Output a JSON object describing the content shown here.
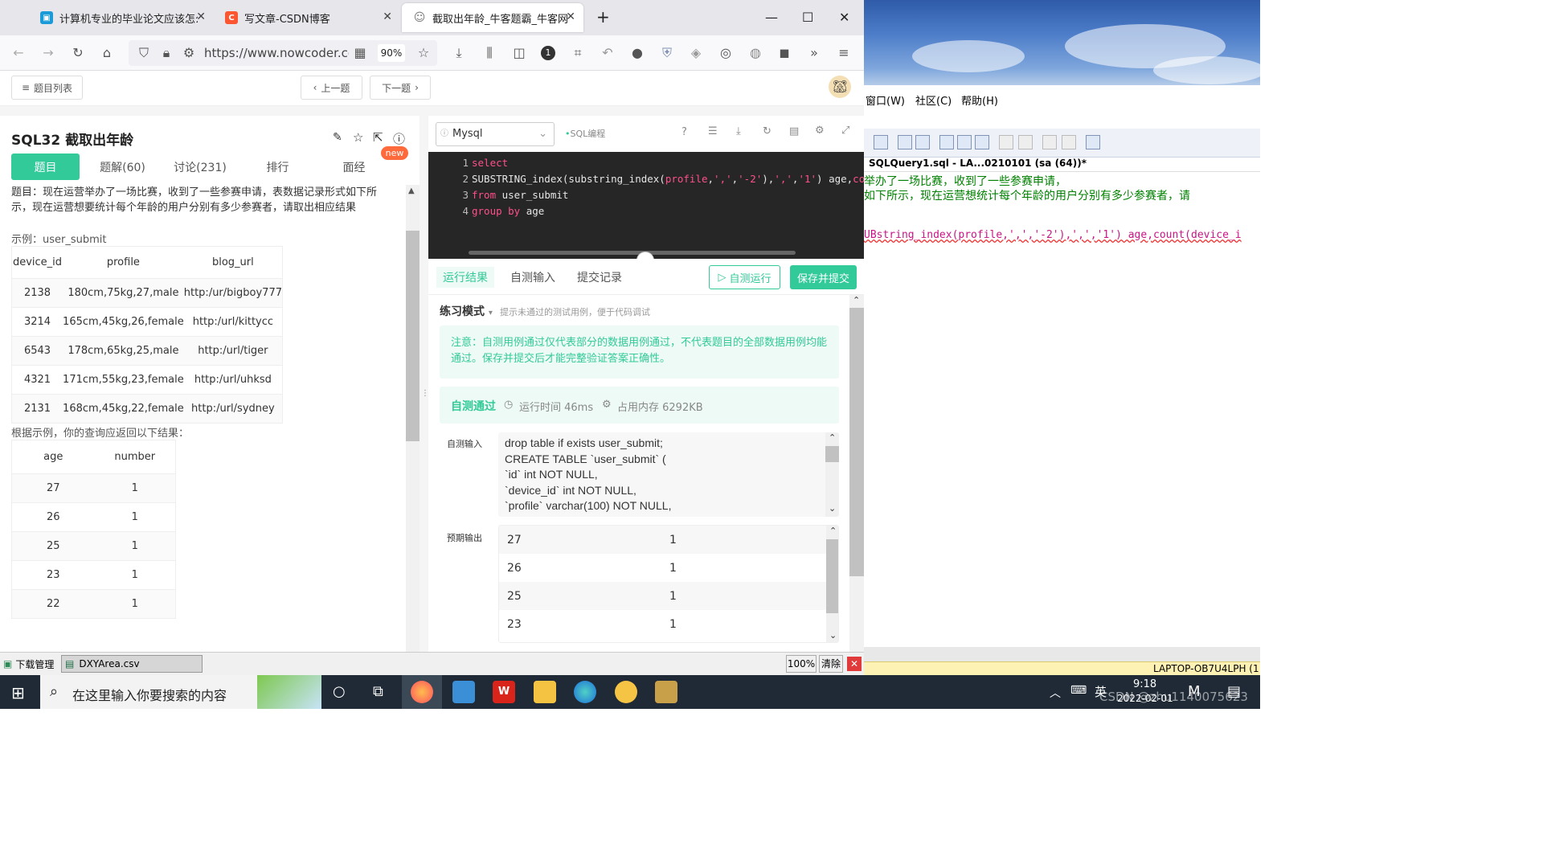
{
  "browser": {
    "tabs": [
      {
        "title": "计算机专业的毕业论文应该怎么"
      },
      {
        "title": "写文章-CSDN博客"
      },
      {
        "title": "截取出年龄_牛客题霸_牛客网"
      }
    ],
    "url": "https://www.nowcoder.com",
    "zoom": "90%"
  },
  "page": {
    "list_button": "题目列表",
    "prev_button": "上一题",
    "next_button": "下一题",
    "title": "SQL32  截取出年龄",
    "new_badge": "new",
    "tabs": [
      "题目",
      "题解(60)",
      "讨论(231)",
      "排行",
      "面经"
    ],
    "description": "题目：现在运营举办了一场比赛，收到了一些参赛申请，表数据记录形式如下所示，现在运营想要统计每个年龄的用户分别有多少参赛者，请取出相应结果",
    "example_label": "示例：user_submit",
    "sample_table": {
      "headers": [
        "device_id",
        "profile",
        "blog_url"
      ],
      "rows": [
        [
          "2138",
          "180cm,75kg,27,male",
          "http:/ur/bigboy777"
        ],
        [
          "3214",
          "165cm,45kg,26,female",
          "http:/url/kittycc"
        ],
        [
          "6543",
          "178cm,65kg,25,male",
          "http:/url/tiger"
        ],
        [
          "4321",
          "171cm,55kg,23,female",
          "http:/url/uhksd"
        ],
        [
          "2131",
          "168cm,45kg,22,female",
          "http:/url/sydney"
        ]
      ]
    },
    "result_label": "根据示例，你的查询应返回以下结果：",
    "result_table": {
      "headers": [
        "age",
        "number"
      ],
      "rows": [
        [
          "27",
          "1"
        ],
        [
          "26",
          "1"
        ],
        [
          "25",
          "1"
        ],
        [
          "23",
          "1"
        ],
        [
          "22",
          "1"
        ]
      ]
    }
  },
  "editor": {
    "language": "Mysql",
    "mode_label": "SQL编程",
    "lines": [
      {
        "n": "1",
        "html": "select"
      },
      {
        "n": "2",
        "html": "SUBSTRING_index(substring_index(profile,',','-2'),',','1') age,count"
      },
      {
        "n": "3",
        "html": "from user_submit"
      },
      {
        "n": "4",
        "html": "group by age"
      }
    ]
  },
  "results": {
    "tabs": [
      "运行结果",
      "自测输入",
      "提交记录"
    ],
    "run_button": "自测运行",
    "submit_button": "保存并提交",
    "practice_mode": "练习模式",
    "practice_hint": "提示未通过的测试用例，便于代码调试",
    "notice": "注意：自测用例通过仅代表部分的数据用例通过，不代表题目的全部数据用例均能通过。保存并提交后才能完整验证答案正确性。",
    "pass_label": "自测通过",
    "runtime": "运行时间 46ms",
    "memory": "占用内存 6292KB",
    "input_label": "自测输入",
    "input_lines": [
      "drop table if exists user_submit;",
      "CREATE TABLE `user_submit` (",
      "`id` int NOT NULL,",
      "`device_id` int NOT NULL,",
      "`profile` varchar(100) NOT NULL,"
    ],
    "expected_label": "预期输出",
    "expected_rows": [
      [
        "27",
        "1"
      ],
      [
        "26",
        "1"
      ],
      [
        "25",
        "1"
      ],
      [
        "23",
        "1"
      ]
    ]
  },
  "downloads": {
    "manager": "下载管理",
    "file": "DXYArea.csv",
    "zoom": "100%",
    "clear": "清除"
  },
  "desktop": {
    "menus": [
      "窗口(W)",
      "社区(C)",
      "帮助(H)"
    ],
    "doc_tab": "SQLQuery1.sql - LA...0210101 (sa (64))*",
    "line1": "举办了一场比赛，收到了一些参赛申请，",
    "line2": "如下所示，现在运营想统计每个年龄的用户分别有多少参赛者，请",
    "code_line": "UBstring_index(profile,',','-2'),',','1')  age,count(device_i",
    "status": "LAPTOP-OB7U4LPH (1"
  },
  "taskbar": {
    "search_placeholder": "在这里输入你要搜索的内容",
    "ime": "英",
    "time": "9:18",
    "date": "2022-02-01",
    "watermark": "CSDN @zhu1140075623"
  },
  "colors": {
    "accent": "#32ca99",
    "editor_bg": "#262626",
    "keyword": "#ff4f8b"
  }
}
